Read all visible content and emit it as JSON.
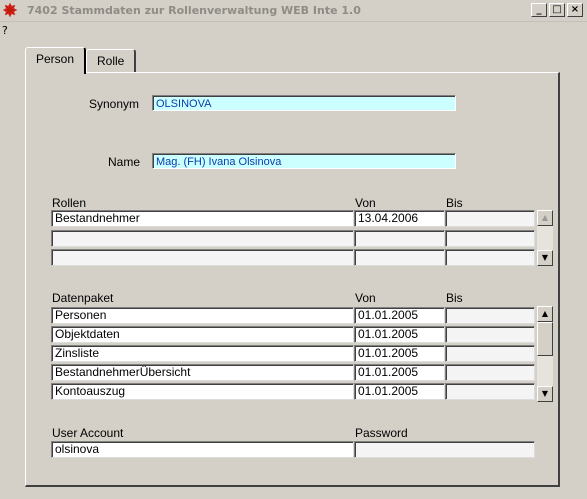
{
  "window": {
    "title": "7402 Stammdaten zur Rollenverwaltung WEB Inte 1.0",
    "minimize": "_",
    "maximize": "□",
    "close": "×"
  },
  "menu": {
    "help": "?"
  },
  "tabs": [
    {
      "label": "Person",
      "active": true
    },
    {
      "label": "Rolle",
      "active": false
    }
  ],
  "person": {
    "synonym_label": "Synonym",
    "synonym_value": "OLSINOVA",
    "name_label": "Name",
    "name_value": "Mag. (FH) Ivana Olsinova"
  },
  "rollen": {
    "headers": {
      "name": "Rollen",
      "von": "Von",
      "bis": "Bis"
    },
    "rows": [
      {
        "name": "Bestandnehmer",
        "von": "13.04.2006",
        "bis": ""
      },
      {
        "name": "",
        "von": "",
        "bis": ""
      },
      {
        "name": "",
        "von": "",
        "bis": ""
      }
    ]
  },
  "datenpaket": {
    "headers": {
      "name": "Datenpaket",
      "von": "Von",
      "bis": "Bis"
    },
    "rows": [
      {
        "name": "Personen",
        "von": "01.01.2005",
        "bis": ""
      },
      {
        "name": "Objektdaten",
        "von": "01.01.2005",
        "bis": ""
      },
      {
        "name": "Zinsliste",
        "von": "01.01.2005",
        "bis": ""
      },
      {
        "name": "BestandnehmerÜbersicht",
        "von": "01.01.2005",
        "bis": ""
      },
      {
        "name": "Kontoauszug",
        "von": "01.01.2005",
        "bis": ""
      }
    ]
  },
  "account": {
    "user_label": "User Account",
    "user_value": "olsinova",
    "password_label": "Password",
    "password_value": ""
  },
  "colors": {
    "background": "#d4d0c8",
    "field_highlight": "#ccffff",
    "field_text": "#0a3db0"
  }
}
